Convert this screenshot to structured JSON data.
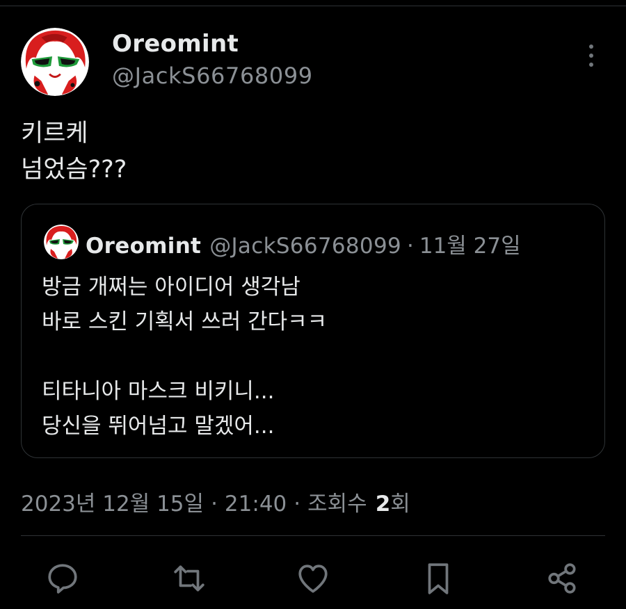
{
  "post": {
    "author_name": "Oreomint",
    "author_handle": "@JackS66768099",
    "text_lines": [
      "키르케",
      "넘었슴???"
    ],
    "avatar_icon": "avatar-red-character-icon",
    "more_icon": "more-vertical-icon"
  },
  "quote": {
    "author_name": "Oreomint",
    "author_handle": "@JackS66768099",
    "separator": "·",
    "date": "11월 27일",
    "text_lines": [
      "방금 개쩌는 아이디어 생각남",
      "바로 스킨 기획서 쓰러 간다ㅋㅋ",
      "",
      "티타니아 마스크 비키니...",
      "당신을 뛰어넘고 말겠어..."
    ]
  },
  "meta": {
    "date": "2023년 12월 15일",
    "separator": "·",
    "time": "21:40",
    "views_label": "조회수",
    "views_count": "2",
    "views_suffix": "회"
  },
  "actions": [
    {
      "name": "reply-icon"
    },
    {
      "name": "retweet-icon"
    },
    {
      "name": "like-icon"
    },
    {
      "name": "bookmark-icon"
    },
    {
      "name": "share-icon"
    }
  ],
  "colors": {
    "background": "#000000",
    "text_primary": "#e7e9ea",
    "text_secondary": "#8b9095",
    "border": "#2f3336",
    "avatar_red": "#d81e1e"
  }
}
